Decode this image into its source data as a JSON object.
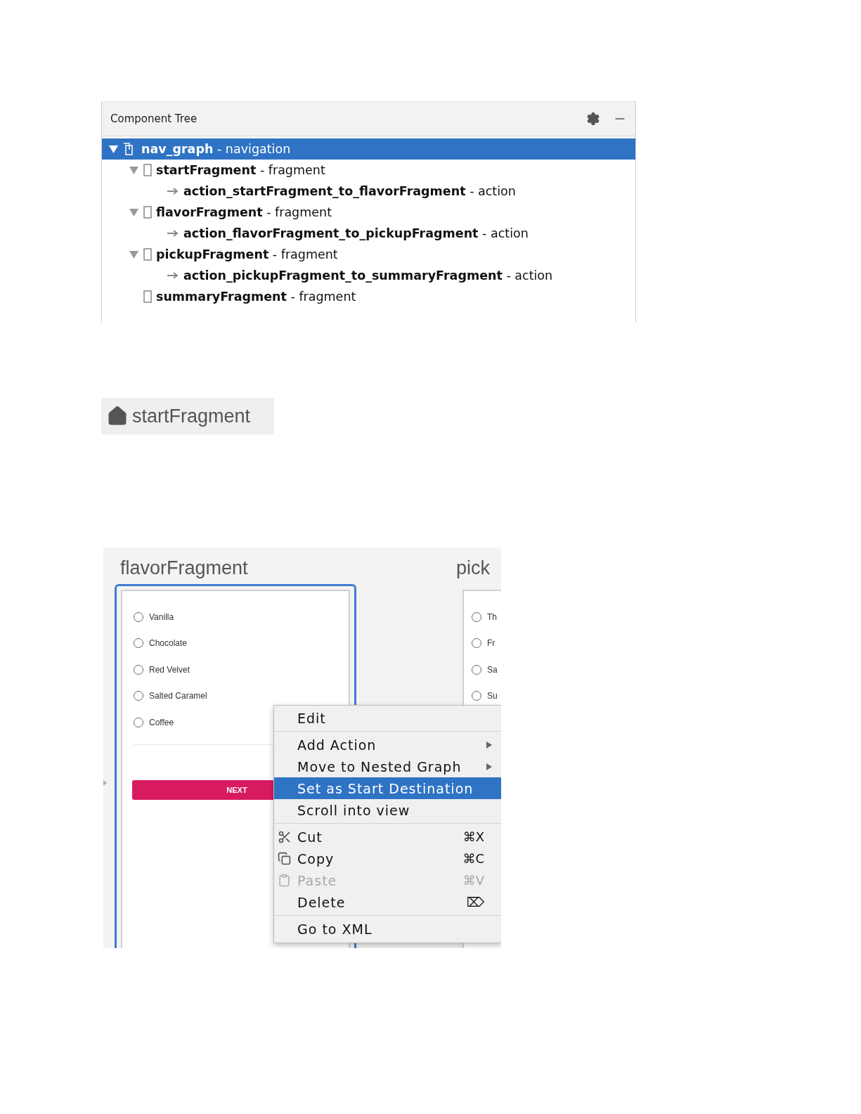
{
  "component_tree": {
    "title": "Component Tree",
    "nodes": [
      {
        "kind": "navigation",
        "name": "nav_graph",
        "suffix": "- navigation",
        "selected": true,
        "expanded": true,
        "children": [
          {
            "kind": "fragment",
            "name": "startFragment",
            "suffix": "- fragment",
            "selected": false,
            "expanded": true,
            "children": [
              {
                "kind": "action",
                "name": "action_startFragment_to_flavorFragment",
                "suffix": "- action",
                "selected": false
              }
            ]
          },
          {
            "kind": "fragment",
            "name": "flavorFragment",
            "suffix": "- fragment",
            "selected": false,
            "expanded": true,
            "children": [
              {
                "kind": "action",
                "name": "action_flavorFragment_to_pickupFragment",
                "suffix": "- action",
                "selected": false
              }
            ]
          },
          {
            "kind": "fragment",
            "name": "pickupFragment",
            "suffix": "- fragment",
            "selected": false,
            "expanded": true,
            "children": [
              {
                "kind": "action",
                "name": "action_pickupFragment_to_summaryFragment",
                "suffix": "- action",
                "selected": false
              }
            ]
          },
          {
            "kind": "fragment",
            "name": "summaryFragment",
            "suffix": "- fragment",
            "selected": false
          }
        ]
      }
    ]
  },
  "start_label": {
    "text": "startFragment"
  },
  "editor": {
    "screens": [
      {
        "title": "flavorFragment",
        "selected": true,
        "options": [
          {
            "label": "Vanilla",
            "selected": false
          },
          {
            "label": "Chocolate",
            "selected": false
          },
          {
            "label": "Red Velvet",
            "selected": false
          },
          {
            "label": "Salted Caramel",
            "selected": false
          },
          {
            "label": "Coffee",
            "selected": false
          }
        ],
        "button": "NEXT"
      },
      {
        "title": "pick",
        "selected": false,
        "options": [
          {
            "label": "Th",
            "selected": false
          },
          {
            "label": "Fr",
            "selected": false
          },
          {
            "label": "Sa",
            "selected": false
          },
          {
            "label": "Su",
            "selected": false
          }
        ]
      }
    ],
    "context_menu": [
      [
        {
          "kind": "plain",
          "label": "Edit",
          "submenu": false,
          "disabled": false,
          "selected": false
        }
      ],
      [
        {
          "kind": "plain",
          "label": "Add Action",
          "submenu": true,
          "disabled": false,
          "selected": false
        },
        {
          "kind": "plain",
          "label": "Move to Nested Graph",
          "submenu": true,
          "disabled": false,
          "selected": false
        },
        {
          "kind": "plain",
          "label": "Set as Start Destination",
          "submenu": false,
          "disabled": false,
          "selected": true
        },
        {
          "kind": "plain",
          "label": "Scroll into view",
          "submenu": false,
          "disabled": false,
          "selected": false
        }
      ],
      [
        {
          "kind": "scissors",
          "label": "Cut",
          "shortcut": "⌘X",
          "submenu": false,
          "disabled": false,
          "selected": false
        },
        {
          "kind": "copy",
          "label": "Copy",
          "shortcut": "⌘C",
          "submenu": false,
          "disabled": false,
          "selected": false
        },
        {
          "kind": "paste",
          "label": "Paste",
          "shortcut": "⌘V",
          "submenu": false,
          "disabled": true,
          "selected": false
        },
        {
          "kind": "plain",
          "label": "Delete",
          "shortcut": "⌦",
          "submenu": false,
          "disabled": false,
          "selected": false
        }
      ],
      [
        {
          "kind": "plain",
          "label": "Go to XML",
          "submenu": false,
          "disabled": false,
          "selected": false
        }
      ]
    ]
  }
}
